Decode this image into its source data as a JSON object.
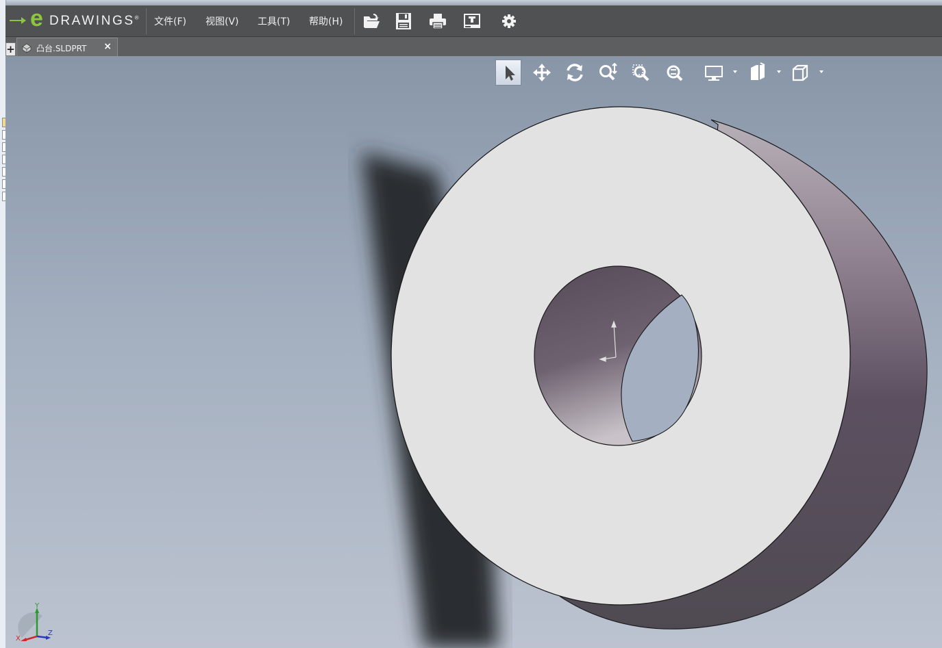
{
  "app": {
    "logo_prefix": "e",
    "logo_word": "DRAWINGS",
    "logo_mark": "®"
  },
  "menu": {
    "items": [
      {
        "label": "文件(F)"
      },
      {
        "label": "视图(V)"
      },
      {
        "label": "工具(T)"
      },
      {
        "label": "帮助(H)"
      }
    ]
  },
  "toolbar": {
    "icons": [
      "open-file-icon",
      "save-icon",
      "print-icon",
      "markup-icon",
      "gear-icon"
    ]
  },
  "tabs": {
    "add_label": "+",
    "active_label": "凸台.SLDPRT",
    "close_label": "×"
  },
  "view_toolbar": {
    "buttons": [
      "select-icon",
      "pan-icon",
      "rotate-icon",
      "zoom-icon",
      "zoom-to-area-icon",
      "zoom-to-fit-icon",
      "display-style-icon",
      "section-view-icon",
      "standard-views-icon"
    ],
    "active": "select-icon"
  },
  "triad": {
    "x_label": "X",
    "y_label": "Y",
    "z_label": "Z"
  },
  "colors": {
    "menubar": "#4f5152",
    "logo_green": "#8cc63f",
    "face_light": "#e2e2e2",
    "face_side": "#6a5e6c"
  }
}
